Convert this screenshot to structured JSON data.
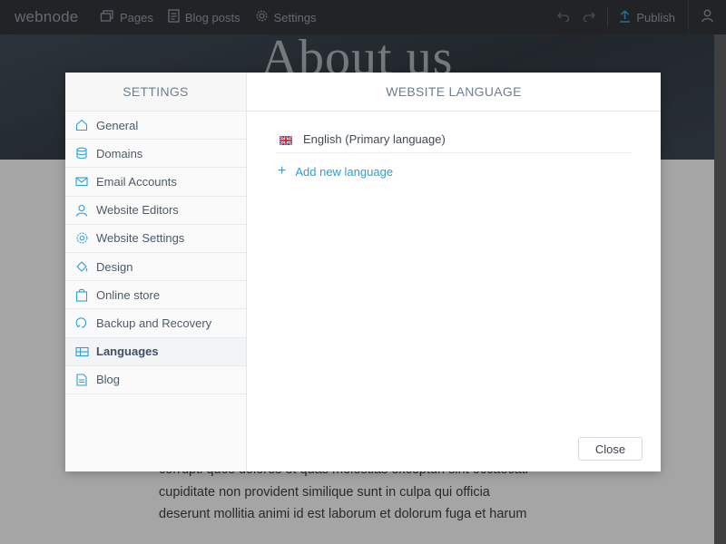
{
  "app": {
    "logo": "webnode",
    "nav": [
      {
        "label": "Pages",
        "icon": "pages-icon"
      },
      {
        "label": "Blog posts",
        "icon": "blog-posts-icon"
      },
      {
        "label": "Settings",
        "icon": "gear-icon"
      }
    ],
    "publish_label": "Publish"
  },
  "page": {
    "hero_title": "About us",
    "body_lines": [
      "corrupti quos dolores et quas molestias excepturi sint occaecati",
      "cupiditate non provident similique sunt in culpa qui officia",
      "deserunt mollitia animi id est laborum et dolorum fuga et harum"
    ]
  },
  "modal": {
    "sidebar_title": "SETTINGS",
    "main_title": "WEBSITE LANGUAGE",
    "sidebar_items": [
      {
        "label": "General",
        "icon": "home-icon",
        "active": false
      },
      {
        "label": "Domains",
        "icon": "database-icon",
        "active": false
      },
      {
        "label": "Email Accounts",
        "icon": "envelope-icon",
        "active": false
      },
      {
        "label": "Website Editors",
        "icon": "user-icon",
        "active": false
      },
      {
        "label": "Website Settings",
        "icon": "gear-icon",
        "active": false
      },
      {
        "label": "Design",
        "icon": "paint-bucket-icon",
        "active": false
      },
      {
        "label": "Online store",
        "icon": "shopping-bag-icon",
        "active": false
      },
      {
        "label": "Backup and Recovery",
        "icon": "restore-icon",
        "active": false
      },
      {
        "label": "Languages",
        "icon": "languages-icon",
        "active": true
      },
      {
        "label": "Blog",
        "icon": "document-icon",
        "active": false
      }
    ],
    "languages": [
      {
        "label": "English (Primary language)",
        "flag": "uk-flag-icon"
      }
    ],
    "add_language_label": "Add new language",
    "close_label": "Close"
  },
  "colors": {
    "accent": "#2a9fd6",
    "topbar": "#1d2128",
    "sidebar_text": "#4e5a6a",
    "header_text": "#6e7d92"
  }
}
